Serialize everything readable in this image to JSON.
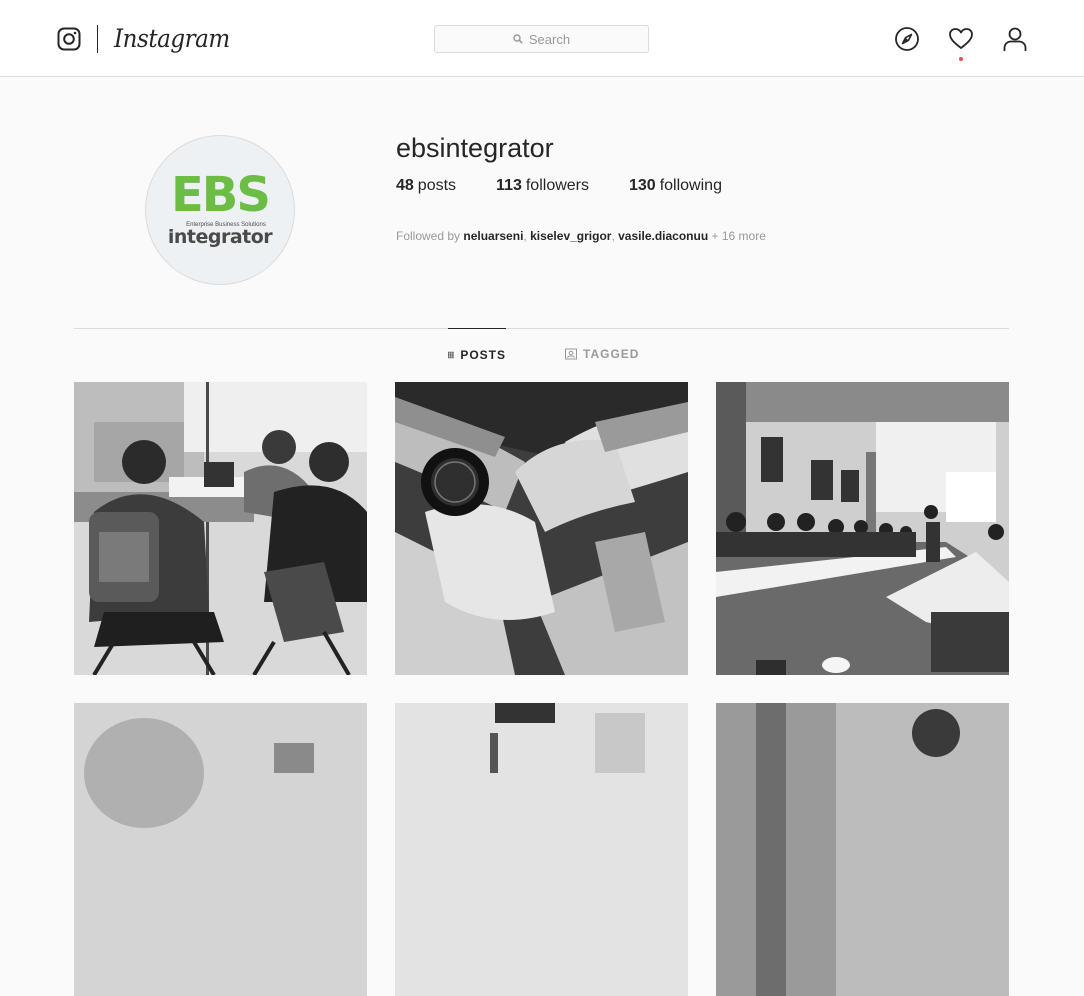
{
  "nav": {
    "brand_wordmark": "Instagram",
    "search": {
      "placeholder": "Search"
    },
    "icons": [
      "instagram-glyph-icon",
      "compass-icon",
      "heart-icon",
      "user-icon"
    ],
    "has_activity_notification": true
  },
  "profile": {
    "username": "ebsintegrator",
    "avatar_text": {
      "main": "EBS",
      "sub": "Enterprise Business Solutions",
      "word": "integrator"
    },
    "stats": {
      "posts": {
        "count": "48",
        "label": "posts"
      },
      "followers": {
        "count": "113",
        "label": "followers"
      },
      "following": {
        "count": "130",
        "label": "following"
      }
    },
    "followed_by": {
      "prefix": "Followed by",
      "users": [
        "neluarseni",
        "kiselev_grigor",
        "vasile.diaconuu"
      ],
      "more": "+ 16 more"
    }
  },
  "tabs": [
    {
      "label": "POSTS",
      "icon": "grid-icon",
      "active": true
    },
    {
      "label": "TAGGED",
      "icon": "tag-icon",
      "active": false
    }
  ],
  "posts": [
    {
      "id": "post-1"
    },
    {
      "id": "post-2"
    },
    {
      "id": "post-3"
    },
    {
      "id": "post-4"
    },
    {
      "id": "post-5"
    },
    {
      "id": "post-6"
    }
  ],
  "colors": {
    "background": "#fafafa",
    "border": "#dbdbdb",
    "text": "#262626",
    "muted": "#999999",
    "brand_green": "#6cbd45",
    "notification_red": "#ed4956"
  }
}
